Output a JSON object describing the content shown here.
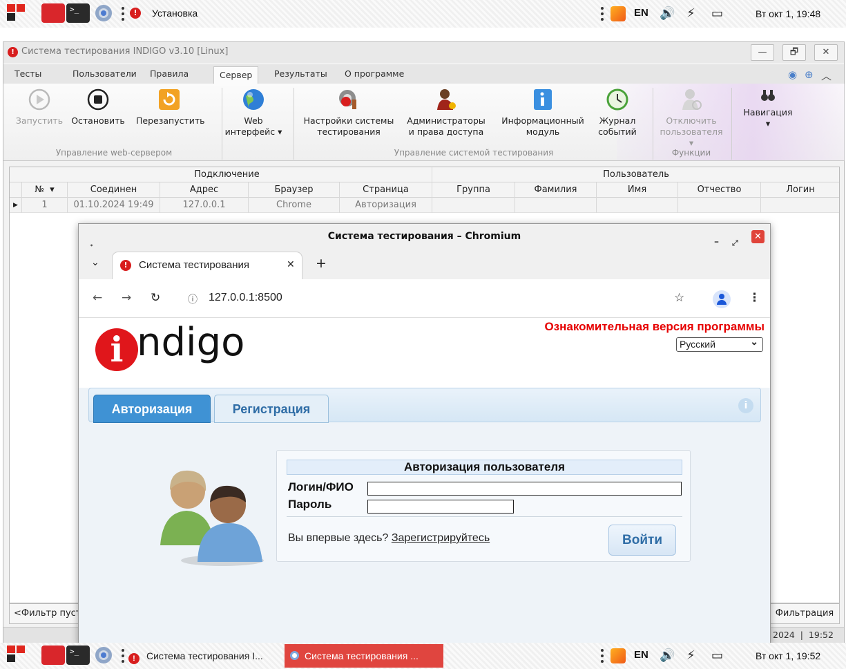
{
  "top_taskbar": {
    "app_label": "Установка",
    "lang": "EN",
    "clock": "Вт окт 1, 19:48"
  },
  "window": {
    "title": "Система тестирования INDIGO v3.10 [Linux]",
    "controls": {
      "minimize": "—",
      "restore": "🗗",
      "close": "✕"
    }
  },
  "menu": {
    "items": [
      "Тесты",
      "Пользователи",
      "Правила",
      "Сервер",
      "Результаты",
      "О программе"
    ],
    "active": "Сервер"
  },
  "ribbon": {
    "start": "Запустить",
    "stop": "Остановить",
    "restart": "Перезапустить",
    "web_line1": "Web",
    "web_line2": "интерфейс ▾",
    "settings_line1": "Настройки системы",
    "settings_line2": "тестирования",
    "admins_line1": "Администраторы",
    "admins_line2": "и права доступа",
    "info_line1": "Информационный",
    "info_line2": "модуль",
    "journal_line1": "Журнал",
    "journal_line2": "событий",
    "disconnect_line1": "Отключить",
    "disconnect_line2": "пользователя ▾",
    "navigation_line1": "Навигация",
    "navigation_line2": "▾",
    "group_webserver": "Управление web-сервером",
    "group_system": "Управление системой тестирования",
    "group_functions": "Функции"
  },
  "grid": {
    "group_connection": "Подключение",
    "group_user": "Пользователь",
    "columns": [
      "№",
      "Соединен",
      "Адрес",
      "Браузер",
      "Страница",
      "Группа",
      "Фамилия",
      "Имя",
      "Отчество",
      "Логин"
    ],
    "rows": [
      [
        "1",
        "01.10.2024 19:49",
        "127.0.0.1",
        "Chrome",
        "Авторизация",
        "",
        "",
        "",
        "",
        ""
      ]
    ],
    "filter_left": "<Фильтр пуст",
    "filter_right": "Фильтрация",
    "status_date": "2024",
    "status_time": "19:52"
  },
  "browser": {
    "window_title": "Система тестирования – Chromium",
    "tab_title": "Система тестирования",
    "url": "127.0.0.1:8500"
  },
  "page": {
    "trial_notice": "Ознакомительная версия программы",
    "language": "Русский",
    "logo_text": "ndigo",
    "tab_login": "Авторизация",
    "tab_register": "Регистрация",
    "auth_title": "Авторизация пользователя",
    "login_label": "Логин/ФИО",
    "password_label": "Пароль",
    "first_time": "Вы впервые здесь?",
    "register_link": "Зарегистрируйтесь",
    "submit": "Войти"
  },
  "bottom_taskbar": {
    "task1": "Система тестирования I...",
    "task2": "Система тестирования ...",
    "lang": "EN",
    "clock": "Вт окт 1, 19:52"
  }
}
